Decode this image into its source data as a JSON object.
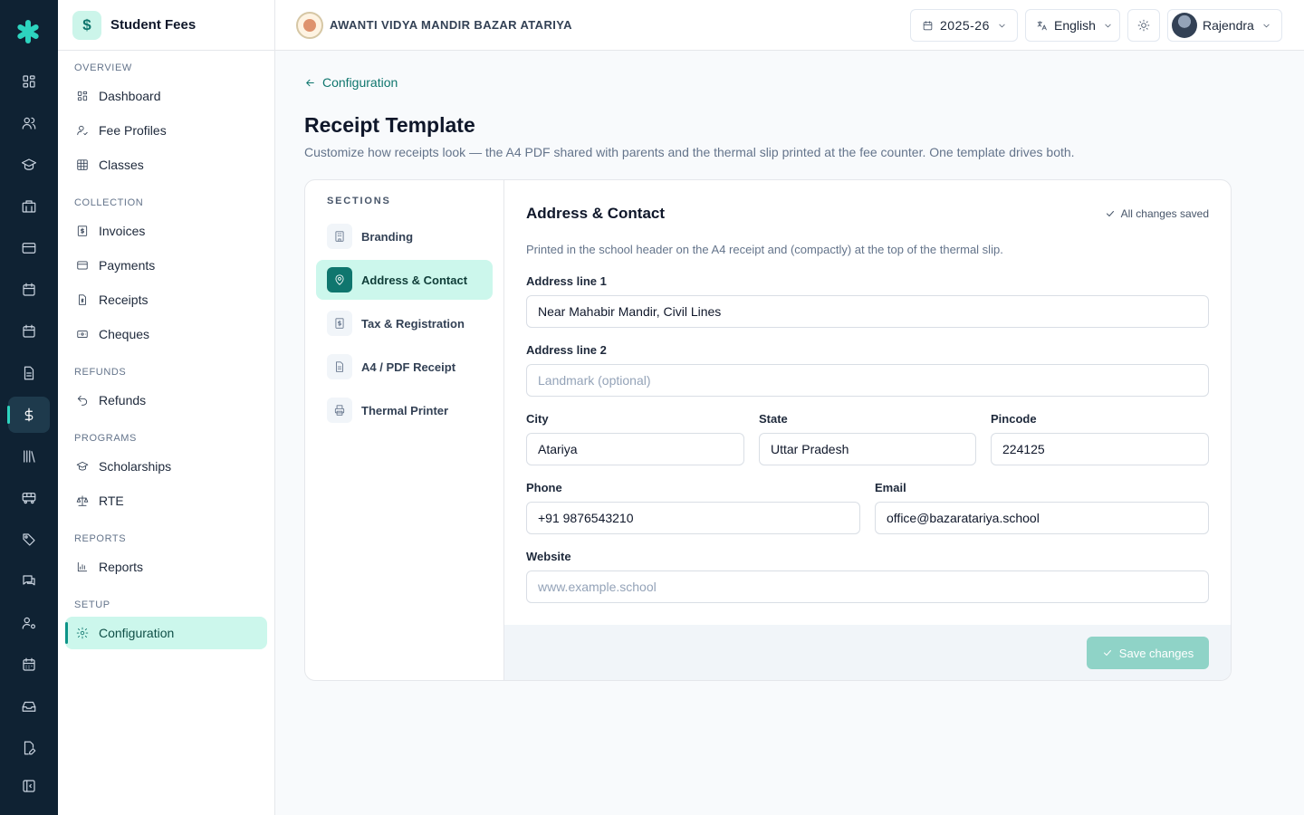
{
  "rail": {
    "icons": [
      "logo-icon",
      "dashboard-icon",
      "users-icon",
      "graduation-cap-icon",
      "building-icon",
      "card-icon",
      "calendar-icon",
      "calendar-alt-icon",
      "document-icon",
      "dollar-icon",
      "library-icon",
      "bus-icon",
      "tag-icon",
      "messages-icon",
      "user-cog-icon",
      "calendar-grid-icon",
      "inbox-icon",
      "file-edit-icon",
      "collapse-panel-icon"
    ],
    "active": "dollar-icon"
  },
  "sidebar": {
    "title": "Student Fees",
    "logo_glyph": "$",
    "sections": {
      "overview": "OVERVIEW",
      "collection": "COLLECTION",
      "refunds": "REFUNDS",
      "programs": "PROGRAMS",
      "reports": "REPORTS",
      "setup": "SETUP"
    },
    "items": {
      "dashboard": "Dashboard",
      "fee_profiles": "Fee Profiles",
      "classes": "Classes",
      "invoices": "Invoices",
      "payments": "Payments",
      "receipts": "Receipts",
      "cheques": "Cheques",
      "refunds": "Refunds",
      "scholarships": "Scholarships",
      "rte": "RTE",
      "reports": "Reports",
      "configuration": "Configuration"
    }
  },
  "topbar": {
    "school_name": "AWANTI VIDYA MANDIR BAZAR ATARIYA",
    "year": "2025-26",
    "language": "English",
    "user": "Rajendra"
  },
  "main": {
    "back_link": "Configuration",
    "title": "Receipt Template",
    "description": "Customize how receipts look — the A4 PDF shared with parents and the thermal slip printed at the fee counter. One template drives both."
  },
  "sections": {
    "label": "SECTIONS",
    "items": {
      "branding": "Branding",
      "address": "Address & Contact",
      "tax": "Tax & Registration",
      "a4": "A4 / PDF Receipt",
      "thermal": "Thermal Printer"
    },
    "active": "address"
  },
  "form": {
    "title": "Address & Contact",
    "status": "All changes saved",
    "description": "Printed in the school header on the A4 receipt and (compactly) at the top of the thermal slip.",
    "fields": {
      "address1": {
        "label": "Address line 1",
        "value": "Near Mahabir Mandir, Civil Lines",
        "placeholder": ""
      },
      "address2": {
        "label": "Address line 2",
        "value": "",
        "placeholder": "Landmark (optional)"
      },
      "city": {
        "label": "City",
        "value": "Atariya",
        "placeholder": ""
      },
      "state": {
        "label": "State",
        "value": "Uttar Pradesh",
        "placeholder": ""
      },
      "pincode": {
        "label": "Pincode",
        "value": "224125",
        "placeholder": ""
      },
      "phone": {
        "label": "Phone",
        "value": "+91 9876543210",
        "placeholder": ""
      },
      "email": {
        "label": "Email",
        "value": "office@bazaratariya.school",
        "placeholder": ""
      },
      "website": {
        "label": "Website",
        "value": "",
        "placeholder": "www.example.school"
      }
    },
    "save_label": "Save changes"
  },
  "colors": {
    "accent": "#0f766e",
    "accent_light": "#ccf7ec",
    "rail_bg": "#0f2233",
    "save_disabled": "#8fd3c7"
  }
}
